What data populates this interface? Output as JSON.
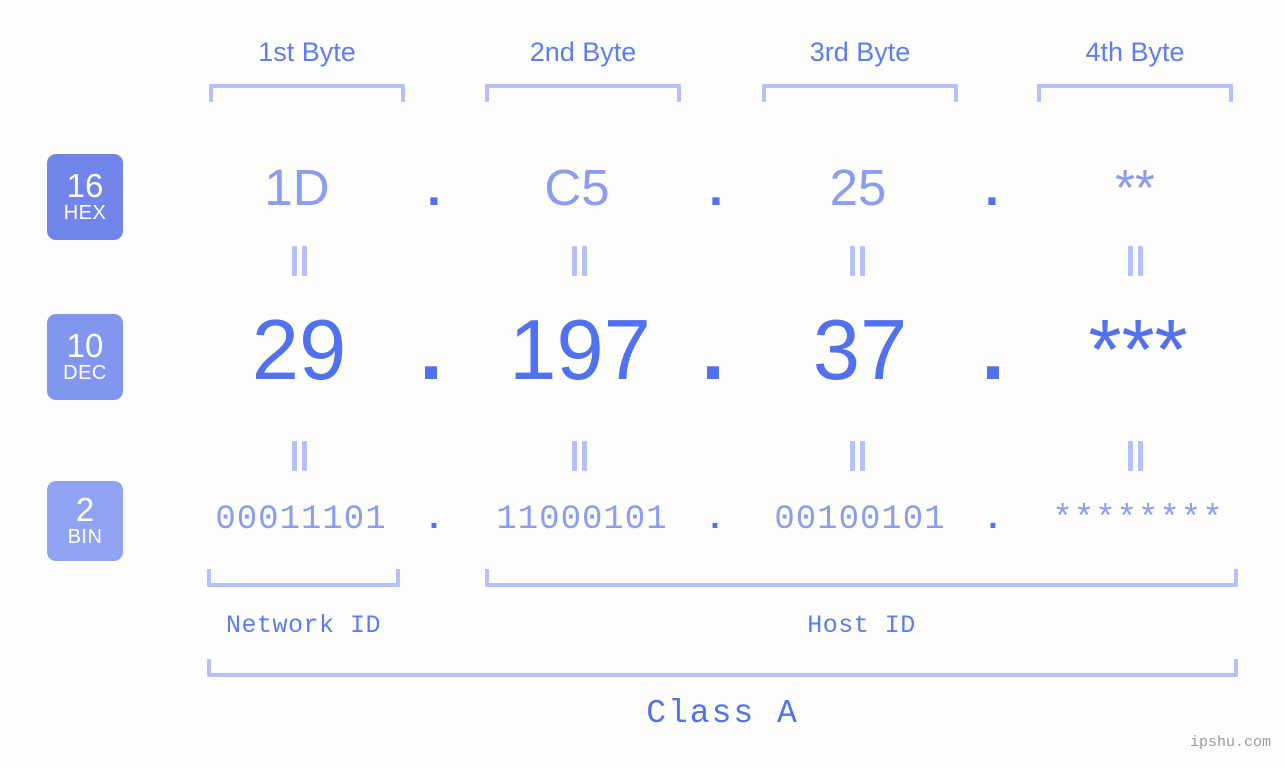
{
  "meta": {
    "watermark": "ipshu.com",
    "background_color": "#fdfefb",
    "accent_color": "#5271f0",
    "accent_light_color": "#8b9cf2",
    "bracket_color": "#b6c0fb"
  },
  "byte_headers": [
    {
      "label": "1st Byte"
    },
    {
      "label": "2nd Byte"
    },
    {
      "label": "3rd Byte"
    },
    {
      "label": "4th Byte"
    }
  ],
  "bases": [
    {
      "number": "16",
      "abbr": "HEX",
      "color": "#7184ea"
    },
    {
      "number": "10",
      "abbr": "DEC",
      "color": "#8396ef"
    },
    {
      "number": "2",
      "abbr": "BIN",
      "color": "#8fa3f2"
    }
  ],
  "rows": {
    "hex": {
      "base_number": "16",
      "base_abbr": "HEX",
      "values": [
        "1D",
        "C5",
        "25",
        "**"
      ],
      "separator": "."
    },
    "dec": {
      "base_number": "10",
      "base_abbr": "DEC",
      "values": [
        "29",
        "197",
        "37",
        "***"
      ],
      "separator": "."
    },
    "bin": {
      "base_number": "2",
      "base_abbr": "BIN",
      "values": [
        "00011101",
        "11000101",
        "00100101",
        "********"
      ],
      "separator": "."
    }
  },
  "equals_symbol": "||",
  "sections": {
    "network_id": "Network ID",
    "host_id": "Host ID",
    "class": "Class A"
  }
}
